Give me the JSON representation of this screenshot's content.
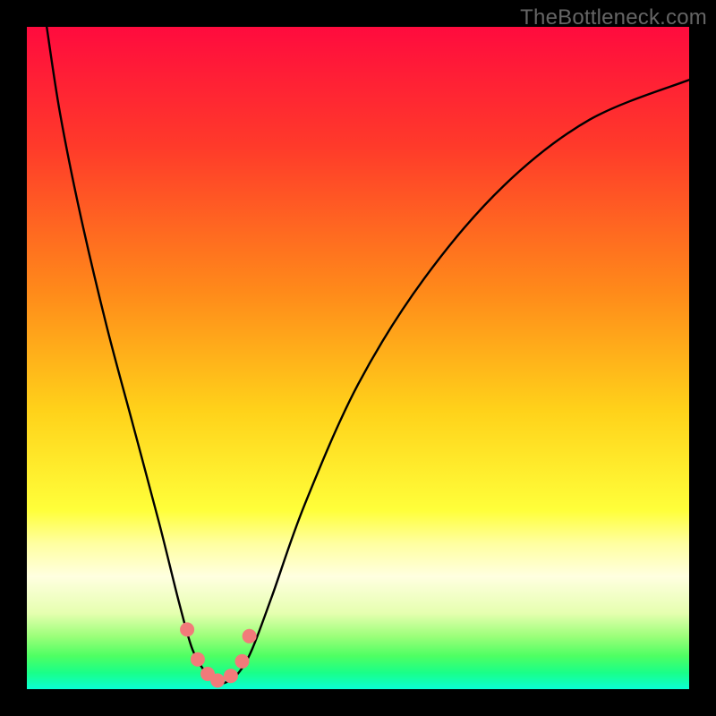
{
  "watermark": "TheBottleneck.com",
  "colors": {
    "black": "#000000",
    "gradient_stops": [
      {
        "offset": 0.0,
        "color": "#ff0b3e"
      },
      {
        "offset": 0.18,
        "color": "#ff3a2a"
      },
      {
        "offset": 0.4,
        "color": "#ff8a1a"
      },
      {
        "offset": 0.58,
        "color": "#ffd21a"
      },
      {
        "offset": 0.73,
        "color": "#ffff3a"
      },
      {
        "offset": 0.78,
        "color": "#ffffa0"
      },
      {
        "offset": 0.83,
        "color": "#ffffe0"
      },
      {
        "offset": 0.885,
        "color": "#e6ffb0"
      },
      {
        "offset": 0.92,
        "color": "#9cff7a"
      },
      {
        "offset": 0.95,
        "color": "#4eff63"
      },
      {
        "offset": 0.975,
        "color": "#1aff88"
      },
      {
        "offset": 1.0,
        "color": "#0affd4"
      }
    ],
    "curve": "#000000",
    "marker_fill": "#f27a7a",
    "marker_stroke": "#9e3a3a"
  },
  "chart_data": {
    "type": "line",
    "title": "",
    "xlabel": "",
    "ylabel": "",
    "xlim": [
      0,
      100
    ],
    "ylim": [
      0,
      100
    ],
    "series": [
      {
        "name": "bottleneck-curve",
        "x": [
          3,
          5,
          8,
          12,
          16,
          20,
          23,
          25,
          27,
          28.5,
          30,
          32,
          34,
          37,
          42,
          50,
          60,
          72,
          85,
          100
        ],
        "y": [
          100,
          87,
          72,
          55,
          40,
          25,
          13,
          6,
          2.5,
          1,
          1,
          2.5,
          6,
          14,
          28,
          46,
          62,
          76,
          86,
          92
        ]
      }
    ],
    "markers": {
      "name": "highlight-points",
      "x": [
        24.2,
        25.8,
        27.3,
        28.8,
        30.8,
        32.5,
        33.6
      ],
      "y": [
        9.0,
        4.5,
        2.3,
        1.3,
        2.0,
        4.2,
        8.0
      ]
    }
  }
}
